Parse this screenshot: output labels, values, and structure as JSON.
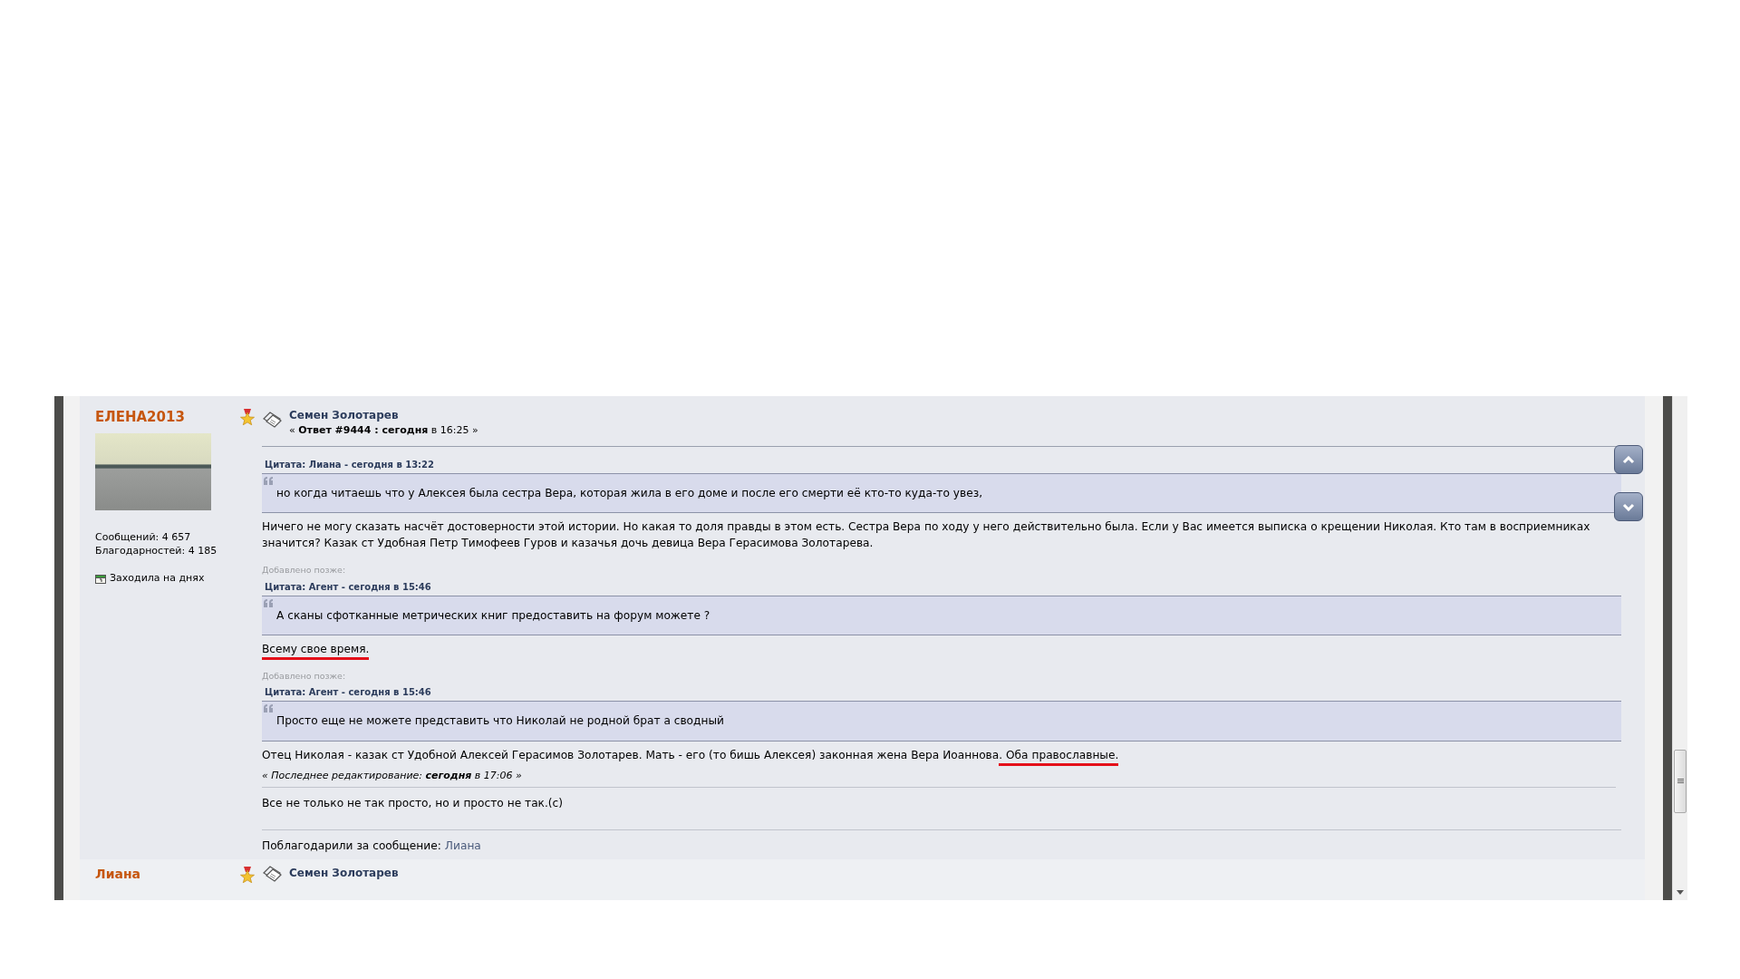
{
  "post": {
    "author": {
      "name": "ЕЛЕНА2013",
      "posts": "Сообщений: 4 657",
      "thanks": "Благодарностей: 4 185",
      "status": "Заходила на днях"
    },
    "subject": "Семен Золотарев",
    "reply_line": "« **Ответ #9444 : сегодня** в 16:25 »",
    "blocks": [
      {
        "kind": "quote",
        "header": "Цитата: Лиана - сегодня в 13:22",
        "text": "но когда читаешь что у Алексея была сестра Вера, которая жила в его доме и после его смерти её кто-то куда-то увез,"
      },
      {
        "kind": "text",
        "parts": [
          {
            "text": "Ничего не могу сказать насчёт достоверности этой истории. Но какая то доля правды в этом есть. Сестра Вера по ходу у него действительно была. Если у Вас имеется выписка о крещении Николая. Кто там в восприемниках значится? Казак ст Удобная Петр Тимофеев Гуров и казачья дочь девица Вера Герасимова Золотарева.",
            "underlined": false
          }
        ]
      },
      {
        "kind": "added",
        "text": "Добавлено позже:"
      },
      {
        "kind": "quote",
        "header": "Цитата: Агент - сегодня в 15:46",
        "text": "А сканы сфотканные метрических книг предоставить на форум можете ?"
      },
      {
        "kind": "text",
        "parts": [
          {
            "text": "Всему свое время.",
            "underlined": true
          }
        ]
      },
      {
        "kind": "added",
        "text": "Добавлено позже:"
      },
      {
        "kind": "quote",
        "header": "Цитата: Агент - сегодня в 15:46",
        "text": "Просто еще не можете представить что Николай не родной брат а сводный"
      },
      {
        "kind": "text",
        "parts": [
          {
            "text": "Отец Николая -  казак ст Удобной Алексей Герасимов Золотарев. Мать - его (то бишь Алексея) законная жена Вера Иоаннова",
            "underlined": false
          },
          {
            "text": ". Оба православные.",
            "underlined": true
          }
        ]
      }
    ],
    "edit_note": "« Последнее редактирование: **сегодня** в 17:06 »",
    "signature": "Все не только не так просто, но и просто не так.(с)",
    "thanks_label": "Поблагодарили за сообщение:",
    "thanked": [
      {
        "name": "Лиана"
      }
    ]
  },
  "next_post": {
    "author": "Лиана",
    "subject": "Семен Золотарев"
  }
}
